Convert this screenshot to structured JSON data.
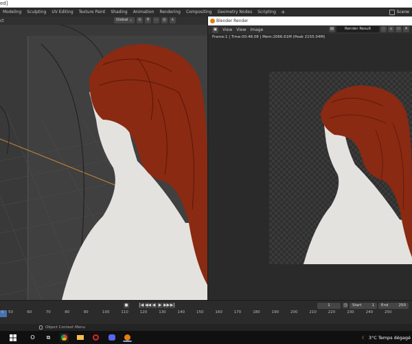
{
  "window": {
    "title_fragment": "ed]"
  },
  "topbar": {
    "tabs": [
      "Modeling",
      "Sculpting",
      "UV Editing",
      "Texture Paint",
      "Shading",
      "Animation",
      "Rendering",
      "Compositing",
      "Geometry Nodes",
      "Scripting"
    ],
    "active_tab": "Scripting",
    "plus": "+",
    "scene_label": "Scene"
  },
  "viewport": {
    "header_left": "ct",
    "orientation": "Global",
    "dropdown_glyph": "⌄"
  },
  "render_window": {
    "title": "Blender Render",
    "menus": [
      "View",
      "View",
      "Image"
    ],
    "slot_name": "Render Result",
    "info": "Frame:1 | Time:00:48.08 | Mem:2066.61M (Peak 2155.04M)"
  },
  "timeline": {
    "current_frame": "1",
    "start_label": "Start",
    "start_value": "1",
    "end_label": "End",
    "end_value": "250",
    "ruler_ticks": [
      "0",
      "50",
      "60",
      "70",
      "80",
      "90",
      "100",
      "110",
      "120",
      "130",
      "140",
      "150",
      "160",
      "170",
      "180",
      "190",
      "200",
      "210",
      "220",
      "230",
      "240",
      "250"
    ],
    "play_glyphs": [
      "●",
      "|◀",
      "◀◀",
      "◀",
      "▶",
      "▶▶",
      "▶|"
    ]
  },
  "statusbar": {
    "text": "Object Context Menu"
  },
  "taskbar": {
    "search_glyph": "O",
    "weather": "3°C  Temps dégagé"
  },
  "colors": {
    "accent_blue": "#4772b3",
    "blender_orange": "#e87d0d",
    "axis_x": "#c98a35",
    "hair": "#8a2a12",
    "skin": "#e8e6e3"
  }
}
